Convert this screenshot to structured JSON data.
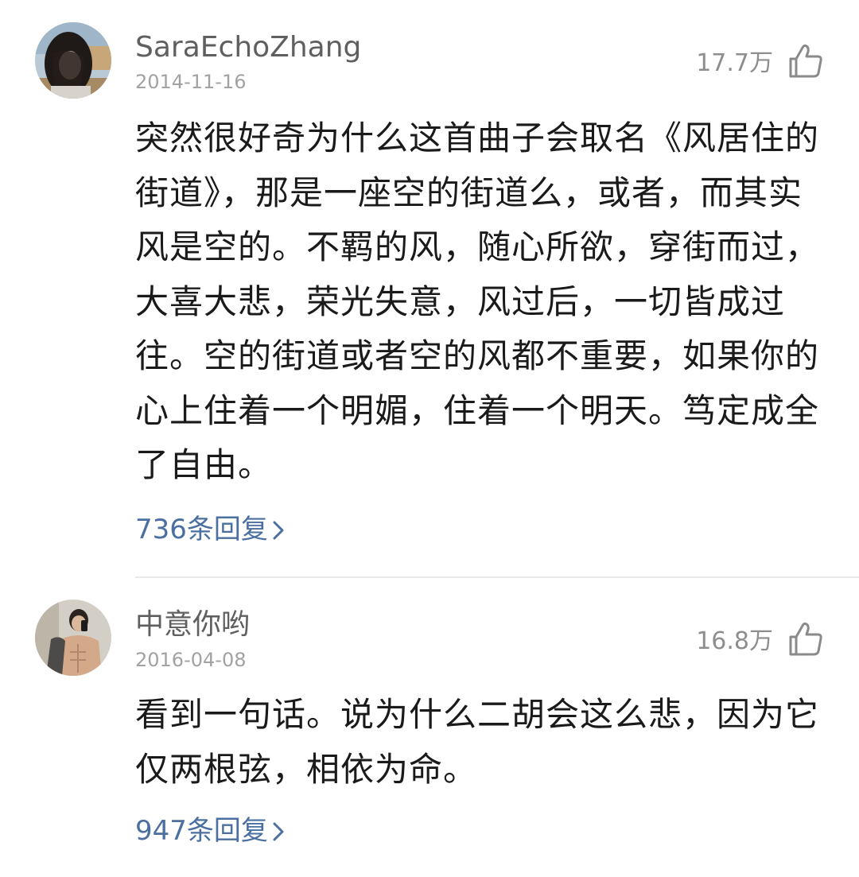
{
  "comments": [
    {
      "username": "SaraEchoZhang",
      "date": "2014-11-16",
      "likes": "17.7万",
      "text": "突然很好奇为什么这首曲子会取名《风居住的\n街道》，那是一座空的街道么，或者，而其实\n风是空的。不羁的风，随心所欲，穿街而过，\n大喜大悲，荣光失意，风过后，一切皆成过\n往。空的街道或者空的风都不重要，如果你的\n心上住着一个明媚，住着一个明天。笃定成全\n了自由。",
      "replies": "736条回复",
      "avatar_icon": "user-photo-avatar"
    },
    {
      "username": "中意你哟",
      "date": "2016-04-08",
      "likes": "16.8万",
      "text": "看到一句话。说为什么二胡会这么悲，因为它\n仅两根弦，相依为命。",
      "replies": "947条回复",
      "avatar_icon": "user-photo-avatar"
    }
  ],
  "icons": {
    "like": "thumbs-up-icon",
    "chevron": "chevron-right-icon"
  },
  "colors": {
    "reply_link": "#4a6fa0",
    "username": "#5f5f5f",
    "body": "#1a1a1a",
    "meta": "#a2a2a2"
  }
}
